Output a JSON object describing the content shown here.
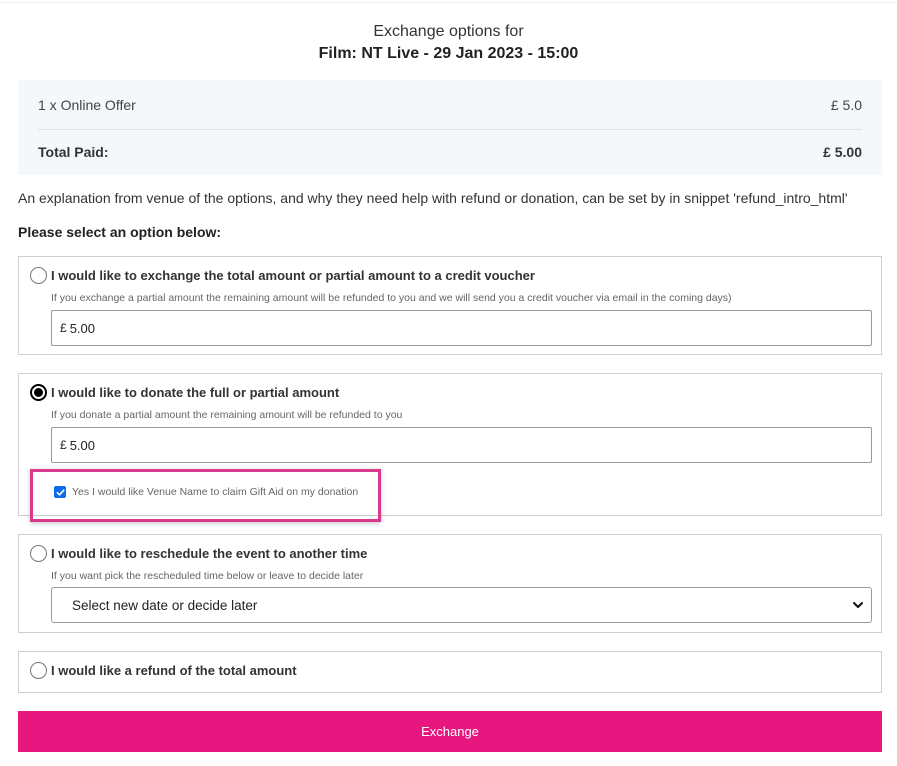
{
  "header": {
    "line1": "Exchange options for",
    "line2": "Film: NT Live - 29 Jan 2023 - 15:00"
  },
  "summary": {
    "item_label": "1 x Online Offer",
    "item_price": "£ 5.0",
    "total_label": "Total Paid:",
    "total_value": "£ 5.00"
  },
  "intro_text": "An explanation from venue of the options, and why they need help with refund or donation, can be set by in snippet 'refund_intro_html'",
  "select_prompt": "Please select an option below:",
  "options": {
    "voucher": {
      "title": "I would like to exchange the total amount or partial amount to a credit voucher",
      "help": "If you exchange a partial amount the remaining amount will be refunded to you and we will send you a credit voucher via email in the coming days)",
      "currency": "£",
      "amount": "5.00",
      "selected": false
    },
    "donate": {
      "title": "I would like to donate the full or partial amount",
      "help": "If you donate a partial amount the remaining amount will be refunded to you",
      "currency": "£",
      "amount": "5.00",
      "selected": true,
      "gift_aid_label": "Yes I would like Venue Name to claim Gift Aid on my donation",
      "gift_aid_checked": true
    },
    "reschedule": {
      "title": "I would like to reschedule the event to another time",
      "help": "If you want pick the rescheduled time below or leave to decide later",
      "select_value": "Select new date or decide later",
      "selected": false
    },
    "refund": {
      "title": "I would like a refund of the total amount",
      "selected": false
    }
  },
  "exchange_button": "Exchange",
  "colors": {
    "accent": "#e6177f",
    "highlight": "#d83a8d",
    "checkbox": "#0a6fe8",
    "summary_bg": "#f5f8fb"
  }
}
